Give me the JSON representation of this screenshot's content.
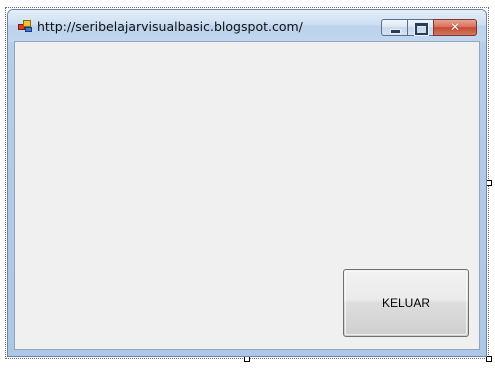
{
  "window": {
    "title": "http://seribelajarvisualbasic.blogspot.com/",
    "icon": "app-form-icon",
    "controls": {
      "minimize_icon": "minimize-icon",
      "maximize_icon": "maximize-icon",
      "close_icon": "close-icon",
      "close_glyph": "✕"
    }
  },
  "form": {
    "buttons": {
      "keluar_label": "KELUAR"
    }
  },
  "colors": {
    "title_bar": "#c3d7ee",
    "client_background": "#f0f0f0",
    "close_button": "#c64a32",
    "frame": "#aec7e6"
  }
}
